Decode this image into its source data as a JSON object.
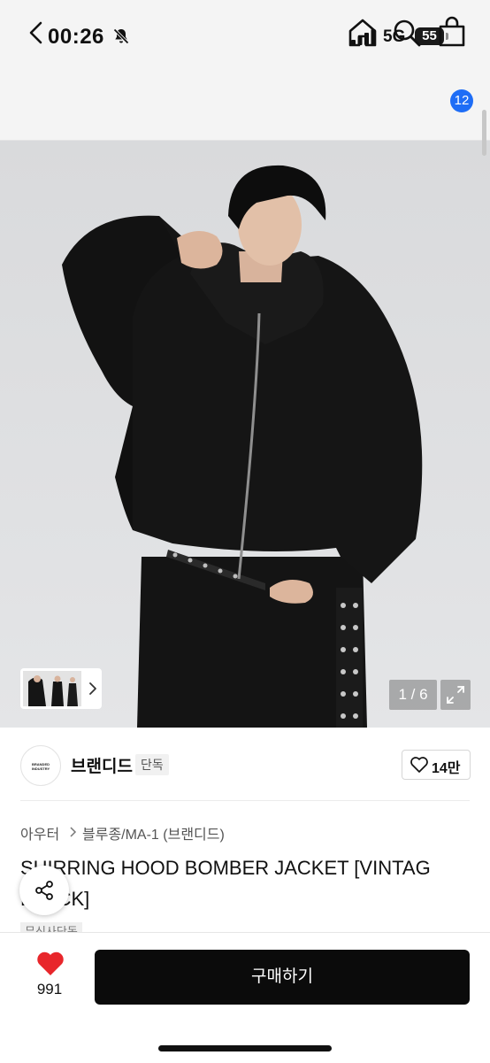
{
  "status_bar": {
    "time": "00:26",
    "network": "5G",
    "battery": "55"
  },
  "nav": {
    "cart_count": "12",
    "icons": [
      "chevron-left-icon",
      "home-icon",
      "search-icon",
      "bag-icon"
    ]
  },
  "gallery": {
    "page_indicator": "1 / 6"
  },
  "brand": {
    "logo_text": "BRANDED INDUSTRY",
    "name": "브랜디드",
    "tag": "단독",
    "likes": "14만"
  },
  "product": {
    "category_1": "아우터",
    "category_2": "블루종/MA-1 (브랜디드)",
    "title_line_1": "SHIRRING HOOD BOMBER JACKET [VINTAG",
    "title_line_2": "BLACK]",
    "exclusive_tag": "무신사단독"
  },
  "bottom_bar": {
    "heart_count": "991",
    "buy_label": "구매하기"
  },
  "colors": {
    "accent": "#1e6df6",
    "heart": "#e8262b",
    "buy_button": "#0b0b0b"
  }
}
